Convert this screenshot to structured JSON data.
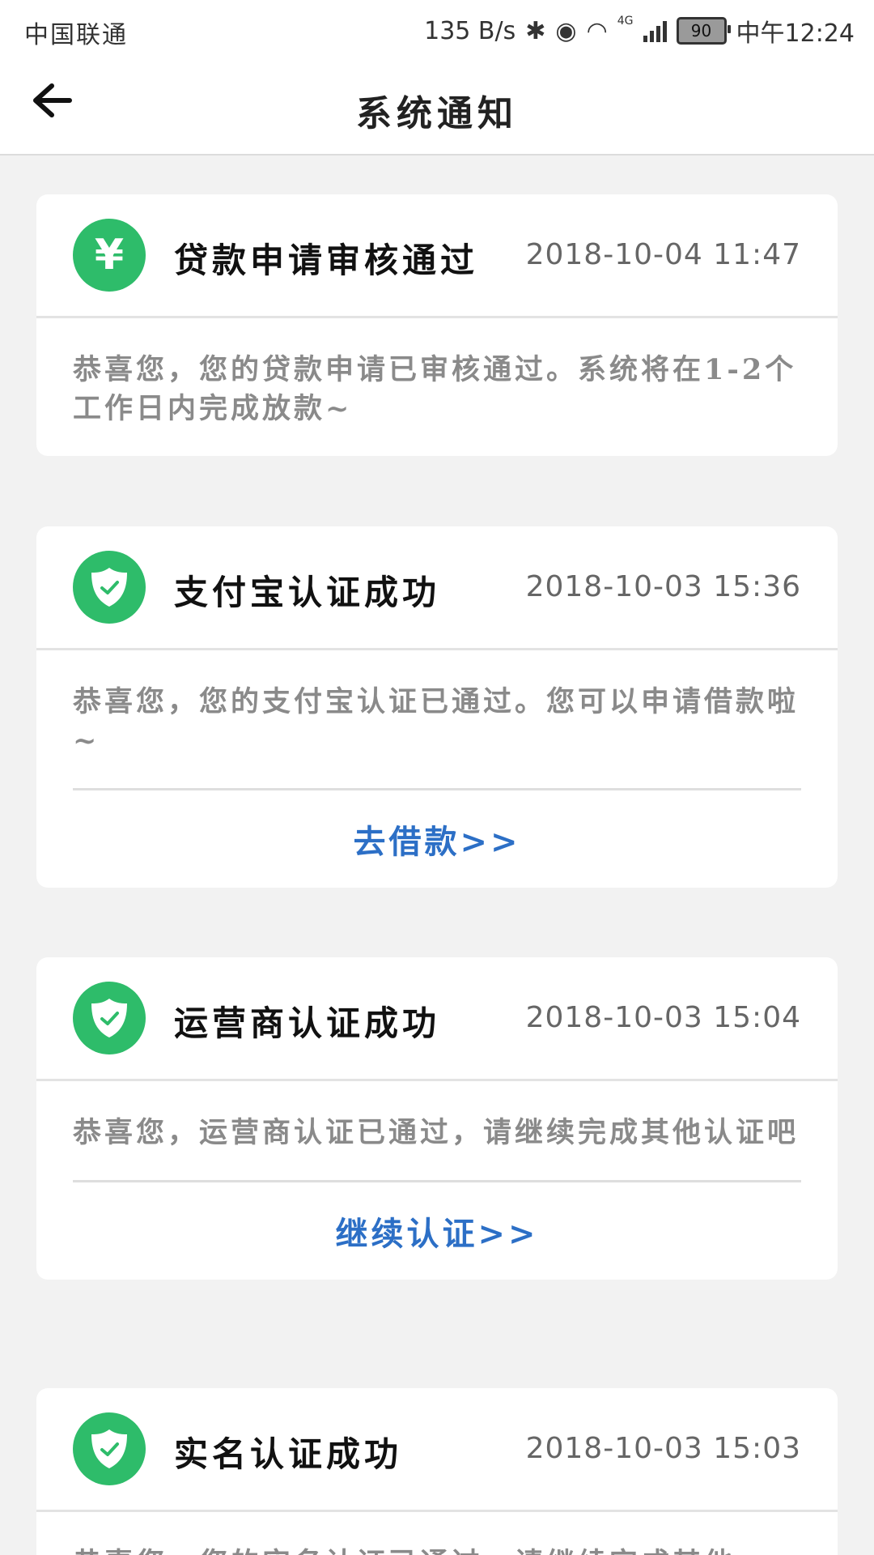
{
  "status_bar": {
    "carrier": "中国联通",
    "net_speed": "135 B/s",
    "network": "4G",
    "battery": "90",
    "time": "中午12:24"
  },
  "header": {
    "title": "系统通知",
    "back_icon": "arrow-left-icon"
  },
  "colors": {
    "icon_green": "#2ebc6a",
    "link_blue": "#2c6fc6",
    "background": "#f2f2f2"
  },
  "notifications": [
    {
      "icon": "yen-icon",
      "title": "贷款申请审核通过",
      "time": "2018-10-04 11:47",
      "message": "恭喜您，您的贷款申请已审核通过。系统将在1-2个工作日内完成放款~",
      "action": ""
    },
    {
      "icon": "shield-check-icon",
      "title": "支付宝认证成功",
      "time": "2018-10-03 15:36",
      "message": "恭喜您，您的支付宝认证已通过。您可以申请借款啦~",
      "action": "去借款>>"
    },
    {
      "icon": "shield-check-icon",
      "title": "运营商认证成功",
      "time": "2018-10-03 15:04",
      "message": "恭喜您，运营商认证已通过，请继续完成其他认证吧",
      "action": "继续认证>>"
    },
    {
      "icon": "shield-check-icon",
      "title": "实名认证成功",
      "time": "2018-10-03 15:03",
      "message": "恭喜您，您的实名认证已通过，请继续完成其他",
      "action": ""
    }
  ]
}
